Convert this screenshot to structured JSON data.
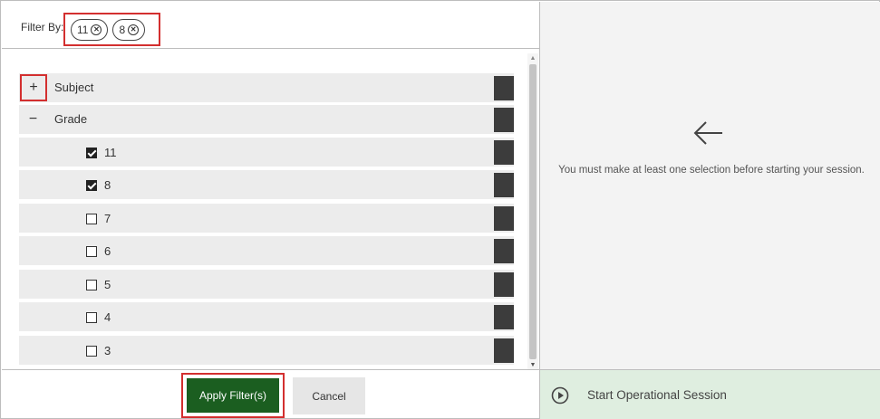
{
  "filter": {
    "label": "Filter By:",
    "chips": [
      "11",
      "8"
    ]
  },
  "tree": {
    "groups": [
      {
        "label": "Subject",
        "toggle": "+",
        "expanded": false
      },
      {
        "label": "Grade",
        "toggle": "−",
        "expanded": true
      }
    ],
    "grade_options": [
      {
        "label": "11",
        "checked": true
      },
      {
        "label": "8",
        "checked": true
      },
      {
        "label": "7",
        "checked": false
      },
      {
        "label": "6",
        "checked": false
      },
      {
        "label": "5",
        "checked": false
      },
      {
        "label": "4",
        "checked": false
      },
      {
        "label": "3",
        "checked": false
      }
    ]
  },
  "footer": {
    "apply_label": "Apply Filter(s)",
    "cancel_label": "Cancel"
  },
  "session": {
    "message": "You must make at least one selection before starting your session.",
    "start_label": "Start Operational Session"
  },
  "icons": {
    "chip_remove": "close-circle-icon",
    "arrow": "arrow-left-icon",
    "play": "play-circle-icon"
  },
  "colors": {
    "apply_button": "#1b5e20",
    "start_bar": "#dfeee0",
    "highlight": "#d32f2f"
  }
}
